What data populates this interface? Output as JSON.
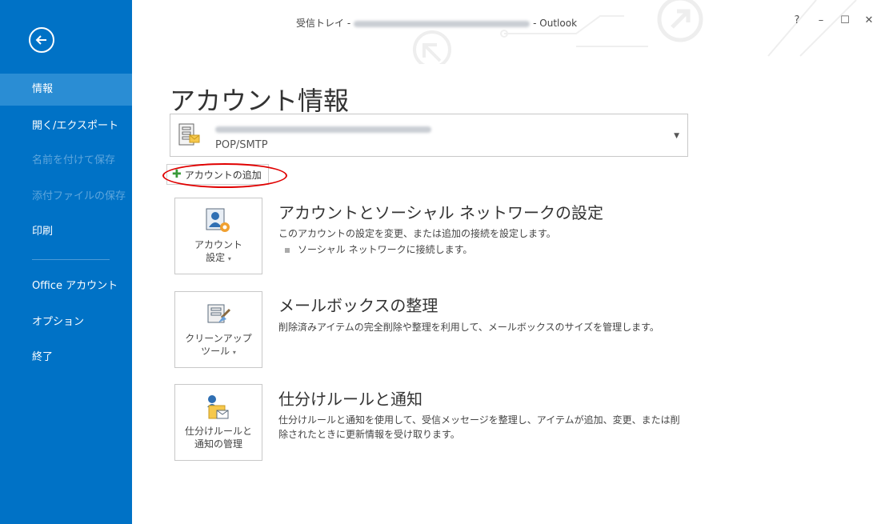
{
  "window": {
    "title_prefix": "受信トレイ -",
    "title_suffix": "- Outlook",
    "controls": [
      "?",
      "–",
      "☐",
      "✕"
    ]
  },
  "sidebar": {
    "items": [
      {
        "label": "情報",
        "state": "active"
      },
      {
        "label": "開く/エクスポート",
        "state": "normal"
      },
      {
        "label": "名前を付けて保存",
        "state": "disabled"
      },
      {
        "label": "添付ファイルの保存",
        "state": "disabled"
      },
      {
        "label": "印刷",
        "state": "normal"
      },
      {
        "label": "Office アカウント",
        "state": "normal"
      },
      {
        "label": "オプション",
        "state": "normal"
      },
      {
        "label": "終了",
        "state": "normal"
      }
    ]
  },
  "main": {
    "title": "アカウント情報",
    "account": {
      "type": "POP/SMTP"
    },
    "add_account_label": "アカウントの追加",
    "sections": [
      {
        "tile_line1": "アカウント",
        "tile_line2": "設定",
        "title": "アカウントとソーシャル ネットワークの設定",
        "desc": "このアカウントの設定を変更、または追加の接続を設定します。",
        "bullet": "ソーシャル ネットワークに接続します。"
      },
      {
        "tile_line1": "クリーンアップ",
        "tile_line2": "ツール",
        "title": "メールボックスの整理",
        "desc": "削除済みアイテムの完全削除や整理を利用して、メールボックスのサイズを管理します。"
      },
      {
        "tile_line1": "仕分けルールと",
        "tile_line2": "通知の管理",
        "title": "仕分けルールと通知",
        "desc": "仕分けルールと通知を使用して、受信メッセージを整理し、アイテムが追加、変更、または削除されたときに更新情報を受け取ります。"
      }
    ]
  },
  "colors": {
    "sidebar": "#0072c6",
    "active": "#2a8dd4",
    "highlight": "#e00000"
  }
}
